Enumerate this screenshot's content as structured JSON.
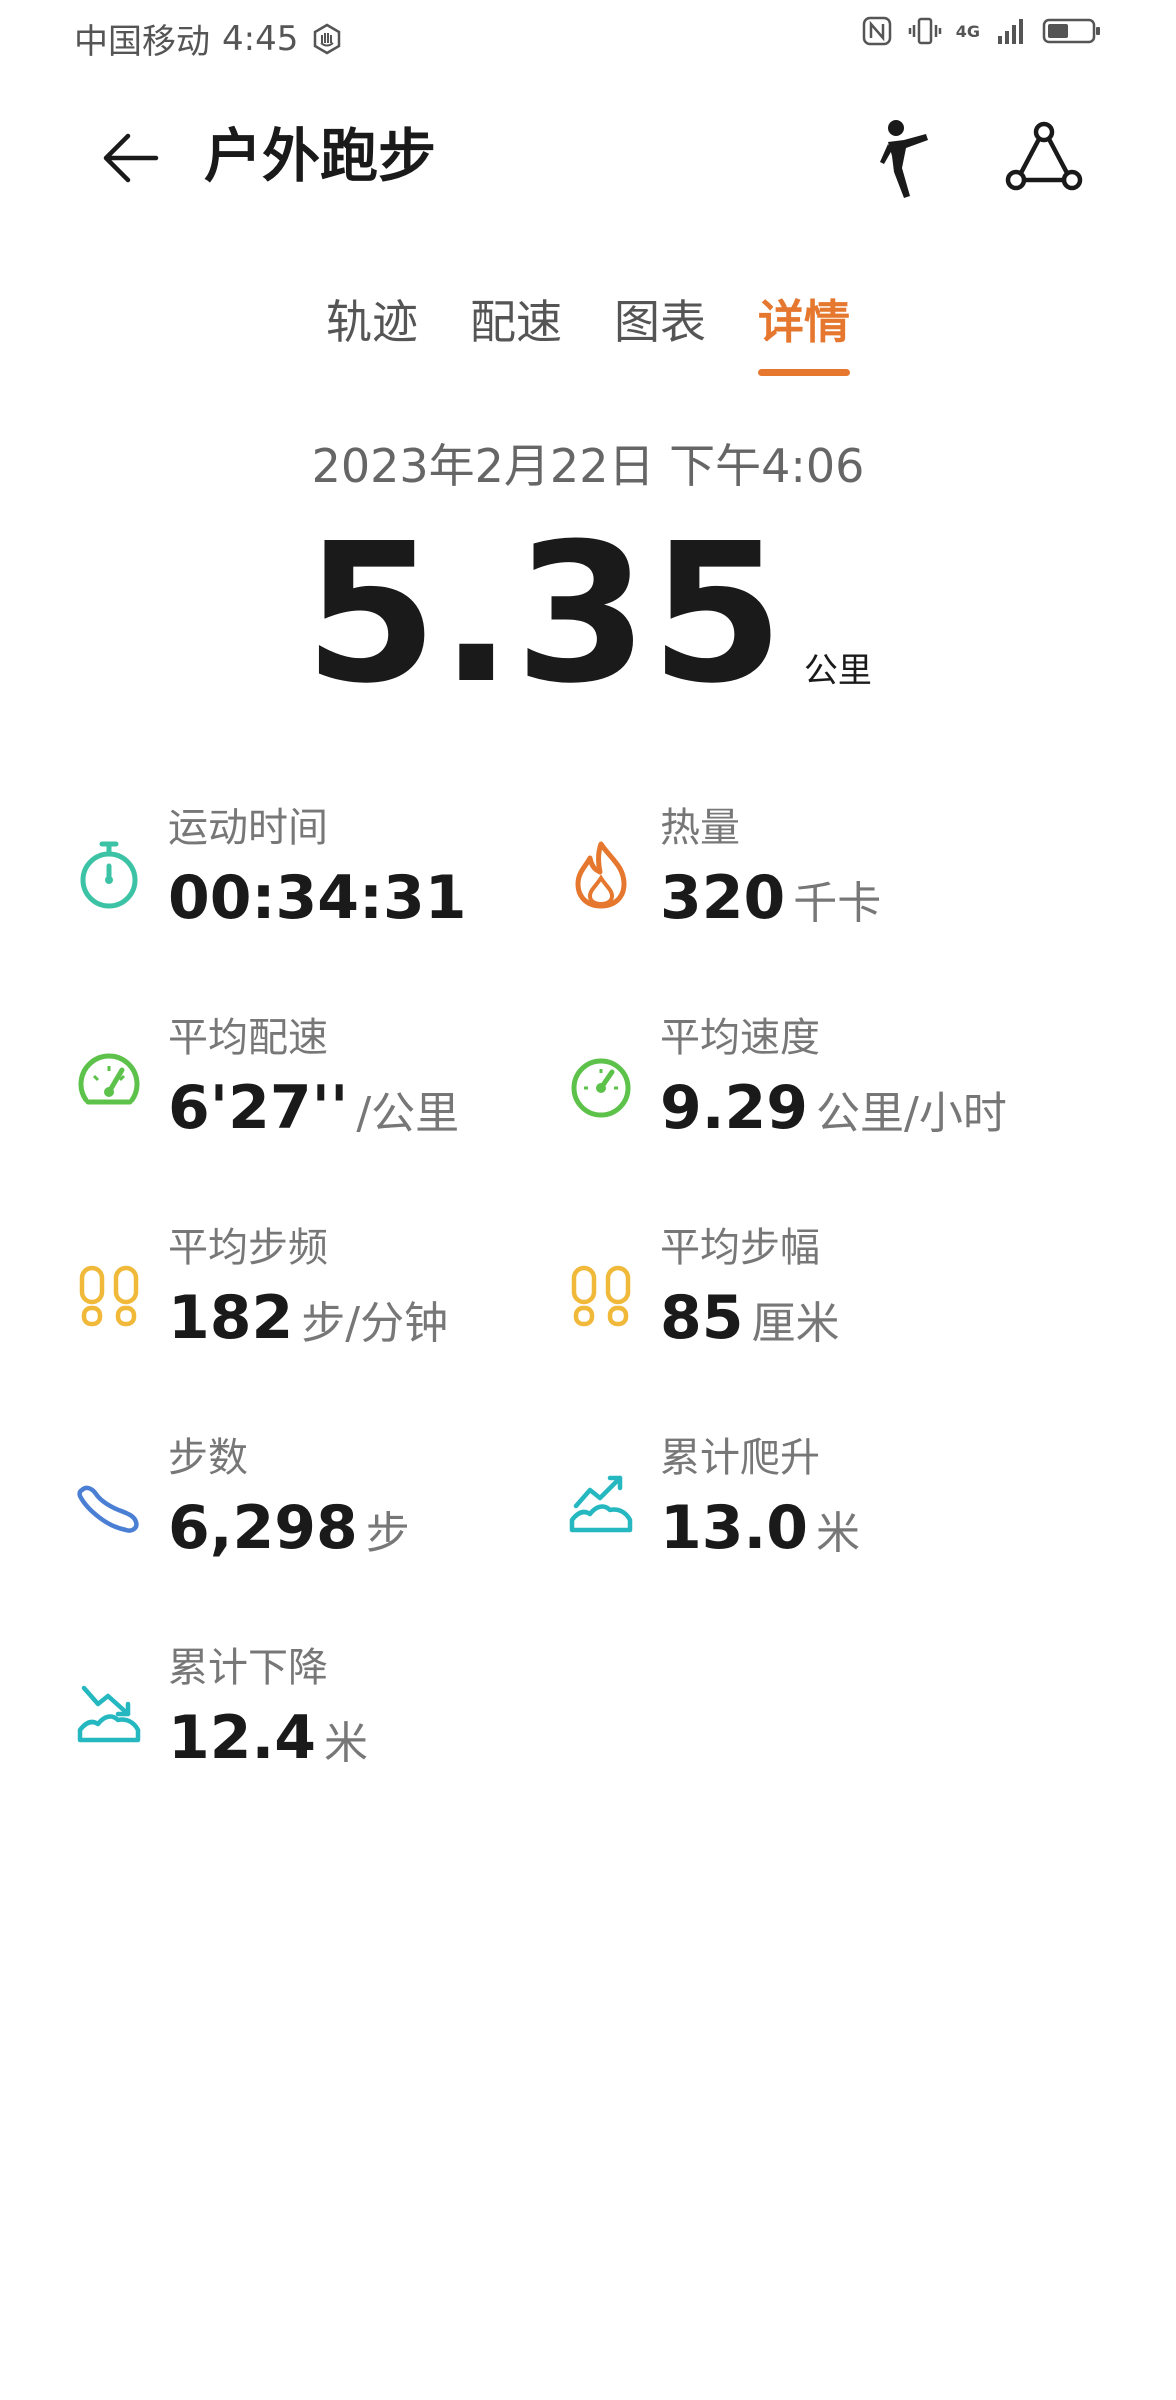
{
  "status_bar": {
    "carrier": "中国移动",
    "time": "4:45",
    "network": "4G"
  },
  "header": {
    "title": "户外跑步"
  },
  "tabs": [
    {
      "label": "轨迹",
      "active": false
    },
    {
      "label": "配速",
      "active": false
    },
    {
      "label": "图表",
      "active": false
    },
    {
      "label": "详情",
      "active": true
    }
  ],
  "summary": {
    "datetime": "2023年2月22日 下午4:06",
    "distance": "5.35",
    "distance_unit": "公里"
  },
  "metrics": [
    {
      "label": "运动时间",
      "value": "00:34:31",
      "unit": "",
      "icon": "stopwatch-icon",
      "color": "#3cc3a6"
    },
    {
      "label": "热量",
      "value": "320",
      "unit": "千卡",
      "icon": "flame-icon",
      "color": "#e5772e"
    },
    {
      "label": "平均配速",
      "value": "6'27''",
      "unit": "/公里",
      "icon": "speedometer-icon",
      "color": "#5cc24a"
    },
    {
      "label": "平均速度",
      "value": "9.29",
      "unit": "公里/小时",
      "icon": "speedometer-icon",
      "color": "#5cc24a"
    },
    {
      "label": "平均步频",
      "value": "182",
      "unit": "步/分钟",
      "icon": "footprints-icon",
      "color": "#f0b93a"
    },
    {
      "label": "平均步幅",
      "value": "85",
      "unit": "厘米",
      "icon": "footprints-icon",
      "color": "#f0b93a"
    },
    {
      "label": "步数",
      "value": "6,298",
      "unit": "步",
      "icon": "shoe-icon",
      "color": "#4a7fd4"
    },
    {
      "label": "累计爬升",
      "value": "13.0",
      "unit": "米",
      "icon": "ascent-icon",
      "color": "#25b8c0"
    },
    {
      "label": "累计下降",
      "value": "12.4",
      "unit": "米",
      "icon": "descent-icon",
      "color": "#25b8c0"
    }
  ]
}
